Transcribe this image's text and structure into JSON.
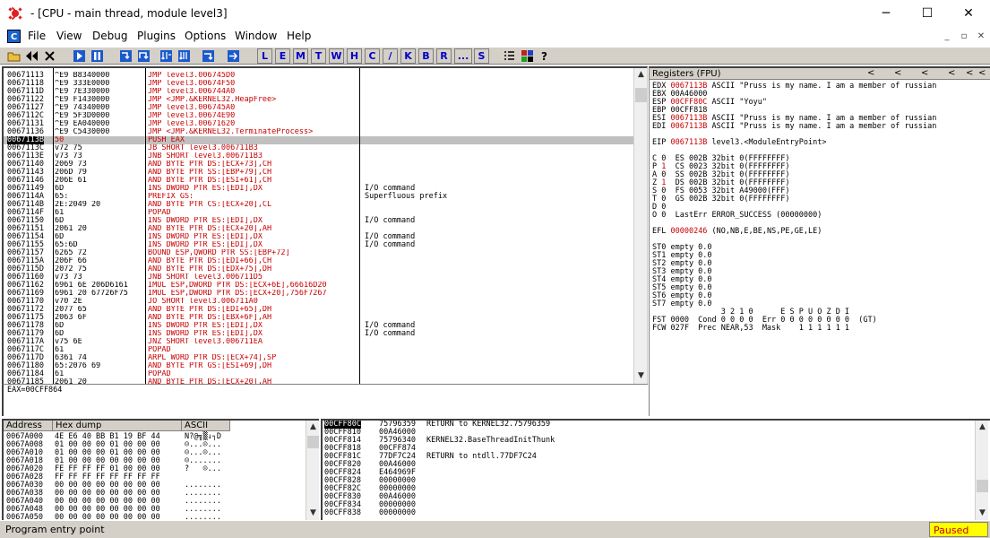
{
  "window": {
    "title": "- [CPU - main thread, module level3]",
    "minimize": "─",
    "maximize": "☐",
    "close": "✕"
  },
  "menu": {
    "badge": "C",
    "items": [
      "File",
      "View",
      "Debug",
      "Plugins",
      "Options",
      "Window",
      "Help"
    ],
    "mdi": [
      "_",
      "▫",
      "✕"
    ]
  },
  "toolbar": {
    "letters": [
      "L",
      "E",
      "M",
      "T",
      "W",
      "H",
      "C",
      "/",
      "K",
      "B",
      "R",
      "...",
      "S"
    ]
  },
  "disassembly": {
    "rows": [
      {
        "addr": "00671113",
        "hex": "^E9 B8340000",
        "dis": "JMP level3.006745D0",
        "com": ""
      },
      {
        "addr": "00671118",
        "hex": "^E9 333E0000",
        "dis": "JMP level3.00674F50",
        "com": ""
      },
      {
        "addr": "0067111D",
        "hex": "^E9 7E330000",
        "dis": "JMP level3.006744A0",
        "com": ""
      },
      {
        "addr": "00671122",
        "hex": "^E9 F1430000",
        "dis": "JMP <JMP.&KERNEL32.HeapFree>",
        "com": ""
      },
      {
        "addr": "00671127",
        "hex": "^E9 74340000",
        "dis": "JMP level3.006745A0",
        "com": ""
      },
      {
        "addr": "0067112C",
        "hex": "^E9 5F3D0000",
        "dis": "JMP level3.00674E90",
        "com": ""
      },
      {
        "addr": "00671131",
        "hex": "^E9 EA040000",
        "dis": "JMP level3.00671620",
        "com": ""
      },
      {
        "addr": "00671136",
        "hex": "^E9 C5430000",
        "dis": "JMP <JMP.&KERNEL32.TerminateProcess>",
        "com": ""
      },
      {
        "addr": "0067113B",
        "hex": "50",
        "dis": "PUSH EAX",
        "com": "",
        "sel": true
      },
      {
        "addr": "0067113C",
        "hex": "v72 75",
        "dis": "JB SHORT level3.006711B3",
        "com": ""
      },
      {
        "addr": "0067113E",
        "hex": "v73 73",
        "dis": "JNB SHORT level3.006711B3",
        "com": ""
      },
      {
        "addr": "00671140",
        "hex": "2069 73",
        "dis": "AND BYTE PTR DS:[ECX+73],CH",
        "com": ""
      },
      {
        "addr": "00671143",
        "hex": "206D 79",
        "dis": "AND BYTE PTR SS:[EBP+79],CH",
        "com": ""
      },
      {
        "addr": "00671146",
        "hex": "206E 61",
        "dis": "AND BYTE PTR DS:[ESI+61],CH",
        "com": ""
      },
      {
        "addr": "00671149",
        "hex": "6D",
        "dis": "INS DWORD PTR ES:[EDI],DX",
        "com": "I/O command"
      },
      {
        "addr": "0067114A",
        "hex": "65:",
        "dis": "PREFIX GS:",
        "com": "Superfluous prefix"
      },
      {
        "addr": "0067114B",
        "hex": "2E:2049 20",
        "dis": "AND BYTE PTR CS:[ECX+20],CL",
        "com": ""
      },
      {
        "addr": "0067114F",
        "hex": "61",
        "dis": "POPAD",
        "com": ""
      },
      {
        "addr": "00671150",
        "hex": "6D",
        "dis": "INS DWORD PTR ES:[EDI],DX",
        "com": "I/O command"
      },
      {
        "addr": "00671151",
        "hex": "2061 20",
        "dis": "AND BYTE PTR DS:[ECX+20],AH",
        "com": ""
      },
      {
        "addr": "00671154",
        "hex": "6D",
        "dis": "INS DWORD PTR ES:[EDI],DX",
        "com": "I/O command"
      },
      {
        "addr": "00671155",
        "hex": "65:6D",
        "dis": "INS DWORD PTR ES:[EDI],DX",
        "com": "I/O command"
      },
      {
        "addr": "00671157",
        "hex": "6265 72",
        "dis": "BOUND ESP,QWORD PTR SS:[EBP+72]",
        "com": ""
      },
      {
        "addr": "0067115A",
        "hex": "206F 66",
        "dis": "AND BYTE PTR DS:[EDI+66],CH",
        "com": ""
      },
      {
        "addr": "0067115D",
        "hex": "2072 75",
        "dis": "AND BYTE PTR DS:[EDX+75],DH",
        "com": ""
      },
      {
        "addr": "00671160",
        "hex": "v73 73",
        "dis": "JNB SHORT level3.006711D5",
        "com": ""
      },
      {
        "addr": "00671162",
        "hex": "6961 6E 206D6161",
        "dis": "IMUL ESP,DWORD PTR DS:[ECX+6E],66616D20",
        "com": ""
      },
      {
        "addr": "00671169",
        "hex": "6961 20 67726F75",
        "dis": "IMUL ESP,DWORD PTR DS:[ECX+20],756F7267",
        "com": ""
      },
      {
        "addr": "00671170",
        "hex": "v70 2E",
        "dis": "JO SHORT level3.006711A0",
        "com": ""
      },
      {
        "addr": "00671172",
        "hex": "2077 65",
        "dis": "AND BYTE PTR DS:[EDI+65],DH",
        "com": ""
      },
      {
        "addr": "00671175",
        "hex": "2063 6F",
        "dis": "AND BYTE PTR DS:[EBX+6F],AH",
        "com": ""
      },
      {
        "addr": "00671178",
        "hex": "6D",
        "dis": "INS DWORD PTR ES:[EDI],DX",
        "com": "I/O command"
      },
      {
        "addr": "00671179",
        "hex": "6D",
        "dis": "INS DWORD PTR ES:[EDI],DX",
        "com": "I/O command"
      },
      {
        "addr": "0067117A",
        "hex": "v75 6E",
        "dis": "JNZ SHORT level3.006711EA",
        "com": ""
      },
      {
        "addr": "0067117C",
        "hex": "61",
        "dis": "POPAD",
        "com": ""
      },
      {
        "addr": "0067117D",
        "hex": "6361 74",
        "dis": "ARPL WORD PTR DS:[ECX+74],SP",
        "com": ""
      },
      {
        "addr": "00671180",
        "hex": "65:2076 69",
        "dis": "AND BYTE PTR GS:[ESI+69],DH",
        "com": ""
      },
      {
        "addr": "00671184",
        "hex": "61",
        "dis": "POPAD",
        "com": ""
      },
      {
        "addr": "00671185",
        "hex": "2061 20",
        "dis": "AND BYTE PTR DS:[ECX+20],AH",
        "com": ""
      }
    ]
  },
  "info": {
    "text": "EAX=00CFF864"
  },
  "registers": {
    "title": "Registers (FPU)",
    "nav": [
      "<",
      "<",
      "<",
      "<",
      "<",
      "<"
    ],
    "lines": [
      {
        "a": "EDX ",
        "b": "0067113B",
        "c": " ASCII \"Pruss is my name. I am a member of russian"
      },
      {
        "a": "EBX ",
        "b": "",
        "c": "00A46000"
      },
      {
        "a": "ESP ",
        "b": "00CFF80C",
        "c": " ASCII \"Yoyu\""
      },
      {
        "a": "EBP ",
        "b": "",
        "c": "00CFF818"
      },
      {
        "a": "ESI ",
        "b": "0067113B",
        "c": " ASCII \"Pruss is my name. I am a member of russian"
      },
      {
        "a": "EDI ",
        "b": "0067113B",
        "c": " ASCII \"Pruss is my name. I am a member of russian"
      },
      {
        "a": "",
        "b": "",
        "c": ""
      },
      {
        "a": "EIP ",
        "b": "0067113B",
        "c": " level3.<ModuleEntryPoint>"
      },
      {
        "a": "",
        "b": "",
        "c": ""
      },
      {
        "a": "C 0  ",
        "b": "",
        "c": "ES 002B 32bit 0(FFFFFFFF)"
      },
      {
        "a": "P ",
        "b": "1",
        "c": "  CS 0023 32bit 0(FFFFFFFF)"
      },
      {
        "a": "A 0  ",
        "b": "",
        "c": "SS 002B 32bit 0(FFFFFFFF)"
      },
      {
        "a": "Z ",
        "b": "1",
        "c": "  DS 002B 32bit 0(FFFFFFFF)"
      },
      {
        "a": "S 0  ",
        "b": "",
        "c": "FS 0053 32bit A49000(FFF)"
      },
      {
        "a": "T 0  ",
        "b": "",
        "c": "GS 002B 32bit 0(FFFFFFFF)"
      },
      {
        "a": "D 0",
        "b": "",
        "c": ""
      },
      {
        "a": "O 0  ",
        "b": "",
        "c": "LastErr ERROR_SUCCESS (00000000)"
      },
      {
        "a": "",
        "b": "",
        "c": ""
      },
      {
        "a": "EFL ",
        "b": "00000246",
        "c": " (NO,NB,E,BE,NS,PE,GE,LE)"
      },
      {
        "a": "",
        "b": "",
        "c": ""
      },
      {
        "a": "ST0 empty 0.0",
        "b": "",
        "c": ""
      },
      {
        "a": "ST1 empty 0.0",
        "b": "",
        "c": ""
      },
      {
        "a": "ST2 empty 0.0",
        "b": "",
        "c": ""
      },
      {
        "a": "ST3 empty 0.0",
        "b": "",
        "c": ""
      },
      {
        "a": "ST4 empty 0.0",
        "b": "",
        "c": ""
      },
      {
        "a": "ST5 empty 0.0",
        "b": "",
        "c": ""
      },
      {
        "a": "ST6 empty 0.0",
        "b": "",
        "c": ""
      },
      {
        "a": "ST7 empty 0.0",
        "b": "",
        "c": ""
      },
      {
        "a": "               3 2 1 0      E S P U O Z D I",
        "b": "",
        "c": ""
      },
      {
        "a": "FST 0000  Cond 0 0 0 0  Err 0 0 0 0 0 0 0 0  (GT)",
        "b": "",
        "c": ""
      },
      {
        "a": "FCW 027F  Prec NEAR,53  Mask    1 1 1 1 1 1",
        "b": "",
        "c": ""
      }
    ]
  },
  "dump": {
    "headers": [
      "Address",
      "Hex dump",
      "ASCII"
    ],
    "rows": [
      {
        "addr": "0067A000",
        "hex": "4E E6 40 BB B1 19 BF 44",
        "ascii": "N?@╗▒↓┐D"
      },
      {
        "addr": "0067A008",
        "hex": "01 00 00 00 01 00 00 00",
        "ascii": "☺...☺..."
      },
      {
        "addr": "0067A010",
        "hex": "01 00 00 00 01 00 00 00",
        "ascii": "☺...☺..."
      },
      {
        "addr": "0067A018",
        "hex": "01 00 00 00 00 00 00 00",
        "ascii": "☺......."
      },
      {
        "addr": "0067A020",
        "hex": "FE FF FF FF 01 00 00 00",
        "ascii": "?   ☺..."
      },
      {
        "addr": "0067A028",
        "hex": "FF FF FF FF FF FF FF FF",
        "ascii": ""
      },
      {
        "addr": "0067A030",
        "hex": "00 00 00 00 00 00 00 00",
        "ascii": "........"
      },
      {
        "addr": "0067A038",
        "hex": "00 00 00 00 00 00 00 00",
        "ascii": "........"
      },
      {
        "addr": "0067A040",
        "hex": "00 00 00 00 00 00 00 00",
        "ascii": "........"
      },
      {
        "addr": "0067A048",
        "hex": "00 00 00 00 00 00 00 00",
        "ascii": "........"
      },
      {
        "addr": "0067A050",
        "hex": "00 00 00 00 00 00 00 00",
        "ascii": "........"
      }
    ]
  },
  "stack": {
    "rows": [
      {
        "addr": "00CFF80C",
        "val": "75796359",
        "com": "RETURN to KERNEL32.75796359",
        "sel": true
      },
      {
        "addr": "00CFF810",
        "val": "00A46000",
        "com": ""
      },
      {
        "addr": "00CFF814",
        "val": "75796340",
        "com": "KERNEL32.BaseThreadInitThunk"
      },
      {
        "addr": "00CFF818",
        "val": "00CFF874",
        "com": ""
      },
      {
        "addr": "00CFF81C",
        "val": "77DF7C24",
        "com": "RETURN to ntdll.77DF7C24"
      },
      {
        "addr": "00CFF820",
        "val": "00A46000",
        "com": ""
      },
      {
        "addr": "00CFF824",
        "val": "E464969F",
        "com": ""
      },
      {
        "addr": "00CFF828",
        "val": "00000000",
        "com": ""
      },
      {
        "addr": "00CFF82C",
        "val": "00000000",
        "com": ""
      },
      {
        "addr": "00CFF830",
        "val": "00A46000",
        "com": ""
      },
      {
        "addr": "00CFF834",
        "val": "00000000",
        "com": ""
      },
      {
        "addr": "00CFF838",
        "val": "00000000",
        "com": ""
      }
    ]
  },
  "status": {
    "text": "Program entry point",
    "state": "Paused"
  }
}
